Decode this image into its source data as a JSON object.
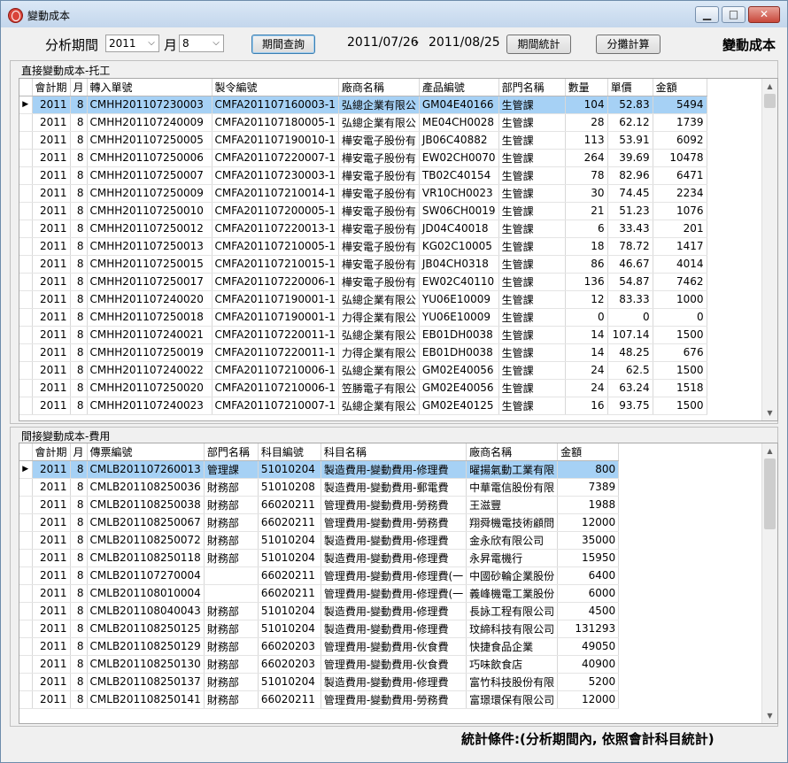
{
  "window": {
    "title": "變動成本",
    "controls": [
      "▁",
      "□",
      "✕"
    ]
  },
  "toolbar": {
    "period_label": "分析期間",
    "year": "2011",
    "month_label": "月",
    "month": "8",
    "query_button": "期間查詢",
    "date_from": "2011/07/26",
    "date_sep": "-",
    "date_to": "2011/08/25",
    "stats_button": "期間統計",
    "allocate_button": "分攤計算",
    "form_title": "變動成本"
  },
  "direct_cost": {
    "title": "直接變動成本-托工",
    "columns": [
      "會計期",
      "月",
      "轉入單號",
      "製令編號",
      "廠商名稱",
      "產品編號",
      "部門名稱",
      "數量",
      "單價",
      "金額"
    ],
    "rows": [
      [
        "2011",
        "8",
        "CMHH201107230003",
        "CMFA201107160003-1",
        "弘總企業有限公",
        "GM04E40166",
        "生管課",
        "104",
        "52.83",
        "5494"
      ],
      [
        "2011",
        "8",
        "CMHH201107240009",
        "CMFA201107180005-1",
        "弘總企業有限公",
        "ME04CH0028",
        "生管課",
        "28",
        "62.12",
        "1739"
      ],
      [
        "2011",
        "8",
        "CMHH201107250005",
        "CMFA201107190010-1",
        "樺安電子股份有",
        "JB06C40882",
        "生管課",
        "113",
        "53.91",
        "6092"
      ],
      [
        "2011",
        "8",
        "CMHH201107250006",
        "CMFA201107220007-1",
        "樺安電子股份有",
        "EW02CH0070",
        "生管課",
        "264",
        "39.69",
        "10478"
      ],
      [
        "2011",
        "8",
        "CMHH201107250007",
        "CMFA201107230003-1",
        "樺安電子股份有",
        "TB02C40154",
        "生管課",
        "78",
        "82.96",
        "6471"
      ],
      [
        "2011",
        "8",
        "CMHH201107250009",
        "CMFA201107210014-1",
        "樺安電子股份有",
        "VR10CH0023",
        "生管課",
        "30",
        "74.45",
        "2234"
      ],
      [
        "2011",
        "8",
        "CMHH201107250010",
        "CMFA201107200005-1",
        "樺安電子股份有",
        "SW06CH0019",
        "生管課",
        "21",
        "51.23",
        "1076"
      ],
      [
        "2011",
        "8",
        "CMHH201107250012",
        "CMFA201107220013-1",
        "樺安電子股份有",
        "JD04C40018",
        "生管課",
        "6",
        "33.43",
        "201"
      ],
      [
        "2011",
        "8",
        "CMHH201107250013",
        "CMFA201107210005-1",
        "樺安電子股份有",
        "KG02C10005",
        "生管課",
        "18",
        "78.72",
        "1417"
      ],
      [
        "2011",
        "8",
        "CMHH201107250015",
        "CMFA201107210015-1",
        "樺安電子股份有",
        "JB04CH0318",
        "生管課",
        "86",
        "46.67",
        "4014"
      ],
      [
        "2011",
        "8",
        "CMHH201107250017",
        "CMFA201107220006-1",
        "樺安電子股份有",
        "EW02C40110",
        "生管課",
        "136",
        "54.87",
        "7462"
      ],
      [
        "2011",
        "8",
        "CMHH201107240020",
        "CMFA201107190001-1",
        "弘總企業有限公",
        "YU06E10009",
        "生管課",
        "12",
        "83.33",
        "1000"
      ],
      [
        "2011",
        "8",
        "CMHH201107250018",
        "CMFA201107190001-1",
        "力得企業有限公",
        "YU06E10009",
        "生管課",
        "0",
        "0",
        "0"
      ],
      [
        "2011",
        "8",
        "CMHH201107240021",
        "CMFA201107220011-1",
        "弘總企業有限公",
        "EB01DH0038",
        "生管課",
        "14",
        "107.14",
        "1500"
      ],
      [
        "2011",
        "8",
        "CMHH201107250019",
        "CMFA201107220011-1",
        "力得企業有限公",
        "EB01DH0038",
        "生管課",
        "14",
        "48.25",
        "676"
      ],
      [
        "2011",
        "8",
        "CMHH201107240022",
        "CMFA201107210006-1",
        "弘總企業有限公",
        "GM02E40056",
        "生管課",
        "24",
        "62.5",
        "1500"
      ],
      [
        "2011",
        "8",
        "CMHH201107250020",
        "CMFA201107210006-1",
        "笠勝電子有限公",
        "GM02E40056",
        "生管課",
        "24",
        "63.24",
        "1518"
      ],
      [
        "2011",
        "8",
        "CMHH201107240023",
        "CMFA201107210007-1",
        "弘總企業有限公",
        "GM02E40125",
        "生管課",
        "16",
        "93.75",
        "1500"
      ]
    ]
  },
  "indirect_cost": {
    "title": "間接變動成本-費用",
    "columns": [
      "會計期",
      "月",
      "傳票編號",
      "部門名稱",
      "科目編號",
      "科目名稱",
      "廠商名稱",
      "金額"
    ],
    "rows": [
      [
        "2011",
        "8",
        "CMLB201107260013",
        "管理課",
        "51010204",
        "製造費用-變動費用-修理費",
        "曜揚氣動工業有限",
        "800"
      ],
      [
        "2011",
        "8",
        "CMLB201108250036",
        "財務部",
        "51010208",
        "製造費用-變動費用-郵電費",
        "中華電信股份有限",
        "7389"
      ],
      [
        "2011",
        "8",
        "CMLB201108250038",
        "財務部",
        "66020211",
        "管理費用-變動費用-勞務費",
        "王滋豐",
        "1988"
      ],
      [
        "2011",
        "8",
        "CMLB201108250067",
        "財務部",
        "66020211",
        "管理費用-變動費用-勞務費",
        "翔舜機電技術顧問",
        "12000"
      ],
      [
        "2011",
        "8",
        "CMLB201108250072",
        "財務部",
        "51010204",
        "製造費用-變動費用-修理費",
        "金永欣有限公司",
        "35000"
      ],
      [
        "2011",
        "8",
        "CMLB201108250118",
        "財務部",
        "51010204",
        "製造費用-變動費用-修理費",
        "永昇電機行",
        "15950"
      ],
      [
        "2011",
        "8",
        "CMLB201107270004",
        "",
        "66020211",
        "管理費用-變動費用-修理費(一",
        "中國砂輪企業股份",
        "6400"
      ],
      [
        "2011",
        "8",
        "CMLB201108010004",
        "",
        "66020211",
        "管理費用-變動費用-修理費(一",
        "義峰機電工業股份",
        "6000"
      ],
      [
        "2011",
        "8",
        "CMLB201108040043",
        "財務部",
        "51010204",
        "製造費用-變動費用-修理費",
        "長詠工程有限公司",
        "4500"
      ],
      [
        "2011",
        "8",
        "CMLB201108250125",
        "財務部",
        "51010204",
        "製造費用-變動費用-修理費",
        "玟締科技有限公司",
        "131293"
      ],
      [
        "2011",
        "8",
        "CMLB201108250129",
        "財務部",
        "66020203",
        "管理費用-變動費用-伙食費",
        "快捷食品企業",
        "49050"
      ],
      [
        "2011",
        "8",
        "CMLB201108250130",
        "財務部",
        "66020203",
        "管理費用-變動費用-伙食費",
        "巧味飲食店",
        "40900"
      ],
      [
        "2011",
        "8",
        "CMLB201108250137",
        "財務部",
        "51010204",
        "製造費用-變動費用-修理費",
        "富竹科技股份有限",
        "5200"
      ],
      [
        "2011",
        "8",
        "CMLB201108250141",
        "財務部",
        "66020211",
        "管理費用-變動費用-勞務費",
        "富璟環保有限公司",
        "12000"
      ]
    ]
  },
  "status": {
    "text": "統計條件:(分析期間內, 依照會計科目統計)"
  },
  "icons": {
    "app": "app-icon",
    "row_pointer": "▶",
    "scroll_up": "▲",
    "scroll_down": "▼",
    "dropdown": "⌵"
  }
}
